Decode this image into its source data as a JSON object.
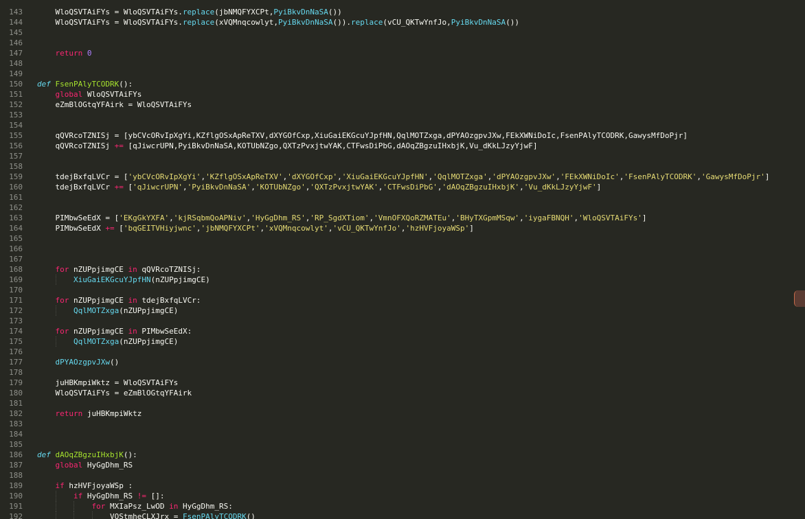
{
  "editor": {
    "theme_colors": {
      "background": "#272822",
      "gutter_text": "#8f908a",
      "keyword": "#f92672",
      "def_keyword": "#66d9ef",
      "function_name": "#a6e22e",
      "call": "#66d9ef",
      "string": "#e6db74",
      "number": "#ae81ff",
      "plain": "#f8f8f2"
    },
    "lines": [
      {
        "n": "143",
        "indent": 1,
        "tokens": [
          [
            "p",
            "WloQSVTAiFYs = WloQSVTAiFYs."
          ],
          [
            "c",
            "replace"
          ],
          [
            "p",
            "(jbNMQFYXCPt,"
          ],
          [
            "c",
            "PyiBkvDnNaSA"
          ],
          [
            "p",
            "())"
          ]
        ]
      },
      {
        "n": "144",
        "indent": 1,
        "tokens": [
          [
            "p",
            "WloQSVTAiFYs = WloQSVTAiFYs."
          ],
          [
            "c",
            "replace"
          ],
          [
            "p",
            "(xVQMnqcowlyt,"
          ],
          [
            "c",
            "PyiBkvDnNaSA"
          ],
          [
            "p",
            "())."
          ],
          [
            "c",
            "replace"
          ],
          [
            "p",
            "(vCU_QKTwYnfJo,"
          ],
          [
            "c",
            "PyiBkvDnNaSA"
          ],
          [
            "p",
            "())"
          ]
        ]
      },
      {
        "n": "145",
        "indent": 0,
        "tokens": []
      },
      {
        "n": "146",
        "indent": 0,
        "tokens": []
      },
      {
        "n": "147",
        "indent": 1,
        "tokens": [
          [
            "k",
            "return"
          ],
          [
            "p",
            " "
          ],
          [
            "n",
            "0"
          ]
        ]
      },
      {
        "n": "148",
        "indent": 0,
        "tokens": []
      },
      {
        "n": "149",
        "indent": 0,
        "tokens": []
      },
      {
        "n": "150",
        "indent": 0,
        "tokens": [
          [
            "d",
            "def"
          ],
          [
            "p",
            " "
          ],
          [
            "f",
            "FsenPAlyTCODRK"
          ],
          [
            "p",
            "():"
          ]
        ]
      },
      {
        "n": "151",
        "indent": 1,
        "tokens": [
          [
            "k",
            "global"
          ],
          [
            "p",
            " WloQSVTAiFYs"
          ]
        ]
      },
      {
        "n": "152",
        "indent": 1,
        "tokens": [
          [
            "p",
            "eZmBlOGtqYFAirk = WloQSVTAiFYs"
          ]
        ]
      },
      {
        "n": "153",
        "indent": 0,
        "tokens": []
      },
      {
        "n": "154",
        "indent": 0,
        "tokens": []
      },
      {
        "n": "155",
        "indent": 1,
        "tokens": [
          [
            "p",
            "qQVRcoTZNISj = [ybCVcORvIpXgYi,KZflgOSxApReTXV,dXYGOfCxp,XiuGaiEKGcuYJpfHN,QqlMOTZxga,dPYAOzgpvJXw,FEkXWNiDoIc,FsenPAlyTCODRK,GawysMfDoPjr]"
          ]
        ]
      },
      {
        "n": "156",
        "indent": 1,
        "tokens": [
          [
            "p",
            "qQVRcoTZNISj "
          ],
          [
            "o",
            "+="
          ],
          [
            "p",
            " [qJiwcrUPN,PyiBkvDnNaSA,KOTUbNZgo,QXTzPvxjtwYAK,CTFwsDiPbG,dAOqZBgzuIHxbjK,Vu_dKkLJzyYjwF]"
          ]
        ]
      },
      {
        "n": "157",
        "indent": 0,
        "tokens": []
      },
      {
        "n": "158",
        "indent": 0,
        "tokens": []
      },
      {
        "n": "159",
        "indent": 1,
        "tokens": [
          [
            "p",
            "tdejBxfqLVCr = ["
          ],
          [
            "s",
            "'ybCVcORvIpXgYi'"
          ],
          [
            "p",
            ","
          ],
          [
            "s",
            "'KZflgOSxApReTXV'"
          ],
          [
            "p",
            ","
          ],
          [
            "s",
            "'dXYGOfCxp'"
          ],
          [
            "p",
            ","
          ],
          [
            "s",
            "'XiuGaiEKGcuYJpfHN'"
          ],
          [
            "p",
            ","
          ],
          [
            "s",
            "'QqlMOTZxga'"
          ],
          [
            "p",
            ","
          ],
          [
            "s",
            "'dPYAOzgpvJXw'"
          ],
          [
            "p",
            ","
          ],
          [
            "s",
            "'FEkXWNiDoIc'"
          ],
          [
            "p",
            ","
          ],
          [
            "s",
            "'FsenPAlyTCODRK'"
          ],
          [
            "p",
            ","
          ],
          [
            "s",
            "'GawysMfDoPjr'"
          ],
          [
            "p",
            "]"
          ]
        ]
      },
      {
        "n": "160",
        "indent": 1,
        "tokens": [
          [
            "p",
            "tdejBxfqLVCr "
          ],
          [
            "o",
            "+="
          ],
          [
            "p",
            " ["
          ],
          [
            "s",
            "'qJiwcrUPN'"
          ],
          [
            "p",
            ","
          ],
          [
            "s",
            "'PyiBkvDnNaSA'"
          ],
          [
            "p",
            ","
          ],
          [
            "s",
            "'KOTUbNZgo'"
          ],
          [
            "p",
            ","
          ],
          [
            "s",
            "'QXTzPvxjtwYAK'"
          ],
          [
            "p",
            ","
          ],
          [
            "s",
            "'CTFwsDiPbG'"
          ],
          [
            "p",
            ","
          ],
          [
            "s",
            "'dAOqZBgzuIHxbjK'"
          ],
          [
            "p",
            ","
          ],
          [
            "s",
            "'Vu_dKkLJzyYjwF'"
          ],
          [
            "p",
            "]"
          ]
        ]
      },
      {
        "n": "161",
        "indent": 0,
        "tokens": []
      },
      {
        "n": "162",
        "indent": 0,
        "tokens": []
      },
      {
        "n": "163",
        "indent": 1,
        "tokens": [
          [
            "p",
            "PIMbwSeEdX = ["
          ],
          [
            "s",
            "'EKgGkYXFA'"
          ],
          [
            "p",
            ","
          ],
          [
            "s",
            "'kjRSqbmQoAPNiv'"
          ],
          [
            "p",
            ","
          ],
          [
            "s",
            "'HyGgDhm_RS'"
          ],
          [
            "p",
            ","
          ],
          [
            "s",
            "'RP_SgdXTiom'"
          ],
          [
            "p",
            ","
          ],
          [
            "s",
            "'VmnOFXQoRZMATEu'"
          ],
          [
            "p",
            ","
          ],
          [
            "s",
            "'BHyTXGpmMSqw'"
          ],
          [
            "p",
            ","
          ],
          [
            "s",
            "'iygaFBNQH'"
          ],
          [
            "p",
            ","
          ],
          [
            "s",
            "'WloQSVTAiFYs'"
          ],
          [
            "p",
            "]"
          ]
        ]
      },
      {
        "n": "164",
        "indent": 1,
        "tokens": [
          [
            "p",
            "PIMbwSeEdX "
          ],
          [
            "o",
            "+="
          ],
          [
            "p",
            " ["
          ],
          [
            "s",
            "'bqGEITVHiyjwnc'"
          ],
          [
            "p",
            ","
          ],
          [
            "s",
            "'jbNMQFYXCPt'"
          ],
          [
            "p",
            ","
          ],
          [
            "s",
            "'xVQMnqcowlyt'"
          ],
          [
            "p",
            ","
          ],
          [
            "s",
            "'vCU_QKTwYnfJo'"
          ],
          [
            "p",
            ","
          ],
          [
            "s",
            "'hzHVFjoyaWSp'"
          ],
          [
            "p",
            "]"
          ]
        ]
      },
      {
        "n": "165",
        "indent": 0,
        "tokens": []
      },
      {
        "n": "166",
        "indent": 0,
        "tokens": []
      },
      {
        "n": "167",
        "indent": 0,
        "tokens": []
      },
      {
        "n": "168",
        "indent": 1,
        "tokens": [
          [
            "k",
            "for"
          ],
          [
            "p",
            " nZUPpjimgCE "
          ],
          [
            "k",
            "in"
          ],
          [
            "p",
            " qQVRcoTZNISj:"
          ]
        ]
      },
      {
        "n": "169",
        "indent": 2,
        "tokens": [
          [
            "c",
            "XiuGaiEKGcuYJpfHN"
          ],
          [
            "p",
            "(nZUPpjimgCE)"
          ]
        ]
      },
      {
        "n": "170",
        "indent": 0,
        "tokens": []
      },
      {
        "n": "171",
        "indent": 1,
        "tokens": [
          [
            "k",
            "for"
          ],
          [
            "p",
            " nZUPpjimgCE "
          ],
          [
            "k",
            "in"
          ],
          [
            "p",
            " tdejBxfqLVCr:"
          ]
        ]
      },
      {
        "n": "172",
        "indent": 2,
        "tokens": [
          [
            "c",
            "QqlMOTZxga"
          ],
          [
            "p",
            "(nZUPpjimgCE)"
          ]
        ]
      },
      {
        "n": "173",
        "indent": 0,
        "tokens": []
      },
      {
        "n": "174",
        "indent": 1,
        "tokens": [
          [
            "k",
            "for"
          ],
          [
            "p",
            " nZUPpjimgCE "
          ],
          [
            "k",
            "in"
          ],
          [
            "p",
            " PIMbwSeEdX:"
          ]
        ]
      },
      {
        "n": "175",
        "indent": 2,
        "tokens": [
          [
            "c",
            "QqlMOTZxga"
          ],
          [
            "p",
            "(nZUPpjimgCE)"
          ]
        ]
      },
      {
        "n": "176",
        "indent": 0,
        "tokens": []
      },
      {
        "n": "177",
        "indent": 1,
        "tokens": [
          [
            "c",
            "dPYAOzgpvJXw"
          ],
          [
            "p",
            "()"
          ]
        ]
      },
      {
        "n": "178",
        "indent": 0,
        "tokens": []
      },
      {
        "n": "179",
        "indent": 1,
        "tokens": [
          [
            "p",
            "juHBKmpiWktz = WloQSVTAiFYs"
          ]
        ]
      },
      {
        "n": "180",
        "indent": 1,
        "tokens": [
          [
            "p",
            "WloQSVTAiFYs = eZmBlOGtqYFAirk"
          ]
        ]
      },
      {
        "n": "181",
        "indent": 0,
        "tokens": []
      },
      {
        "n": "182",
        "indent": 1,
        "tokens": [
          [
            "k",
            "return"
          ],
          [
            "p",
            " juHBKmpiWktz"
          ]
        ]
      },
      {
        "n": "183",
        "indent": 0,
        "tokens": []
      },
      {
        "n": "184",
        "indent": 0,
        "tokens": []
      },
      {
        "n": "185",
        "indent": 0,
        "tokens": []
      },
      {
        "n": "186",
        "indent": 0,
        "tokens": [
          [
            "d",
            "def"
          ],
          [
            "p",
            " "
          ],
          [
            "f",
            "dAOqZBgzuIHxbjK"
          ],
          [
            "p",
            "():"
          ]
        ]
      },
      {
        "n": "187",
        "indent": 1,
        "tokens": [
          [
            "k",
            "global"
          ],
          [
            "p",
            " HyGgDhm_RS"
          ]
        ]
      },
      {
        "n": "188",
        "indent": 0,
        "tokens": []
      },
      {
        "n": "189",
        "indent": 1,
        "tokens": [
          [
            "k",
            "if"
          ],
          [
            "p",
            " hzHVFjoyaWSp :"
          ]
        ]
      },
      {
        "n": "190",
        "indent": 2,
        "tokens": [
          [
            "k",
            "if"
          ],
          [
            "p",
            " HyGgDhm_RS "
          ],
          [
            "o",
            "!="
          ],
          [
            "p",
            " []:"
          ]
        ]
      },
      {
        "n": "191",
        "indent": 3,
        "tokens": [
          [
            "k",
            "for"
          ],
          [
            "p",
            " MXIaPsz_LwOD "
          ],
          [
            "k",
            "in"
          ],
          [
            "p",
            " HyGgDhm_RS:"
          ]
        ]
      },
      {
        "n": "192",
        "indent": 4,
        "tokens": [
          [
            "p",
            "VOStmheCLXJrx = "
          ],
          [
            "c",
            "FsenPAlyTCODRK"
          ],
          [
            "p",
            "()"
          ]
        ]
      }
    ]
  }
}
